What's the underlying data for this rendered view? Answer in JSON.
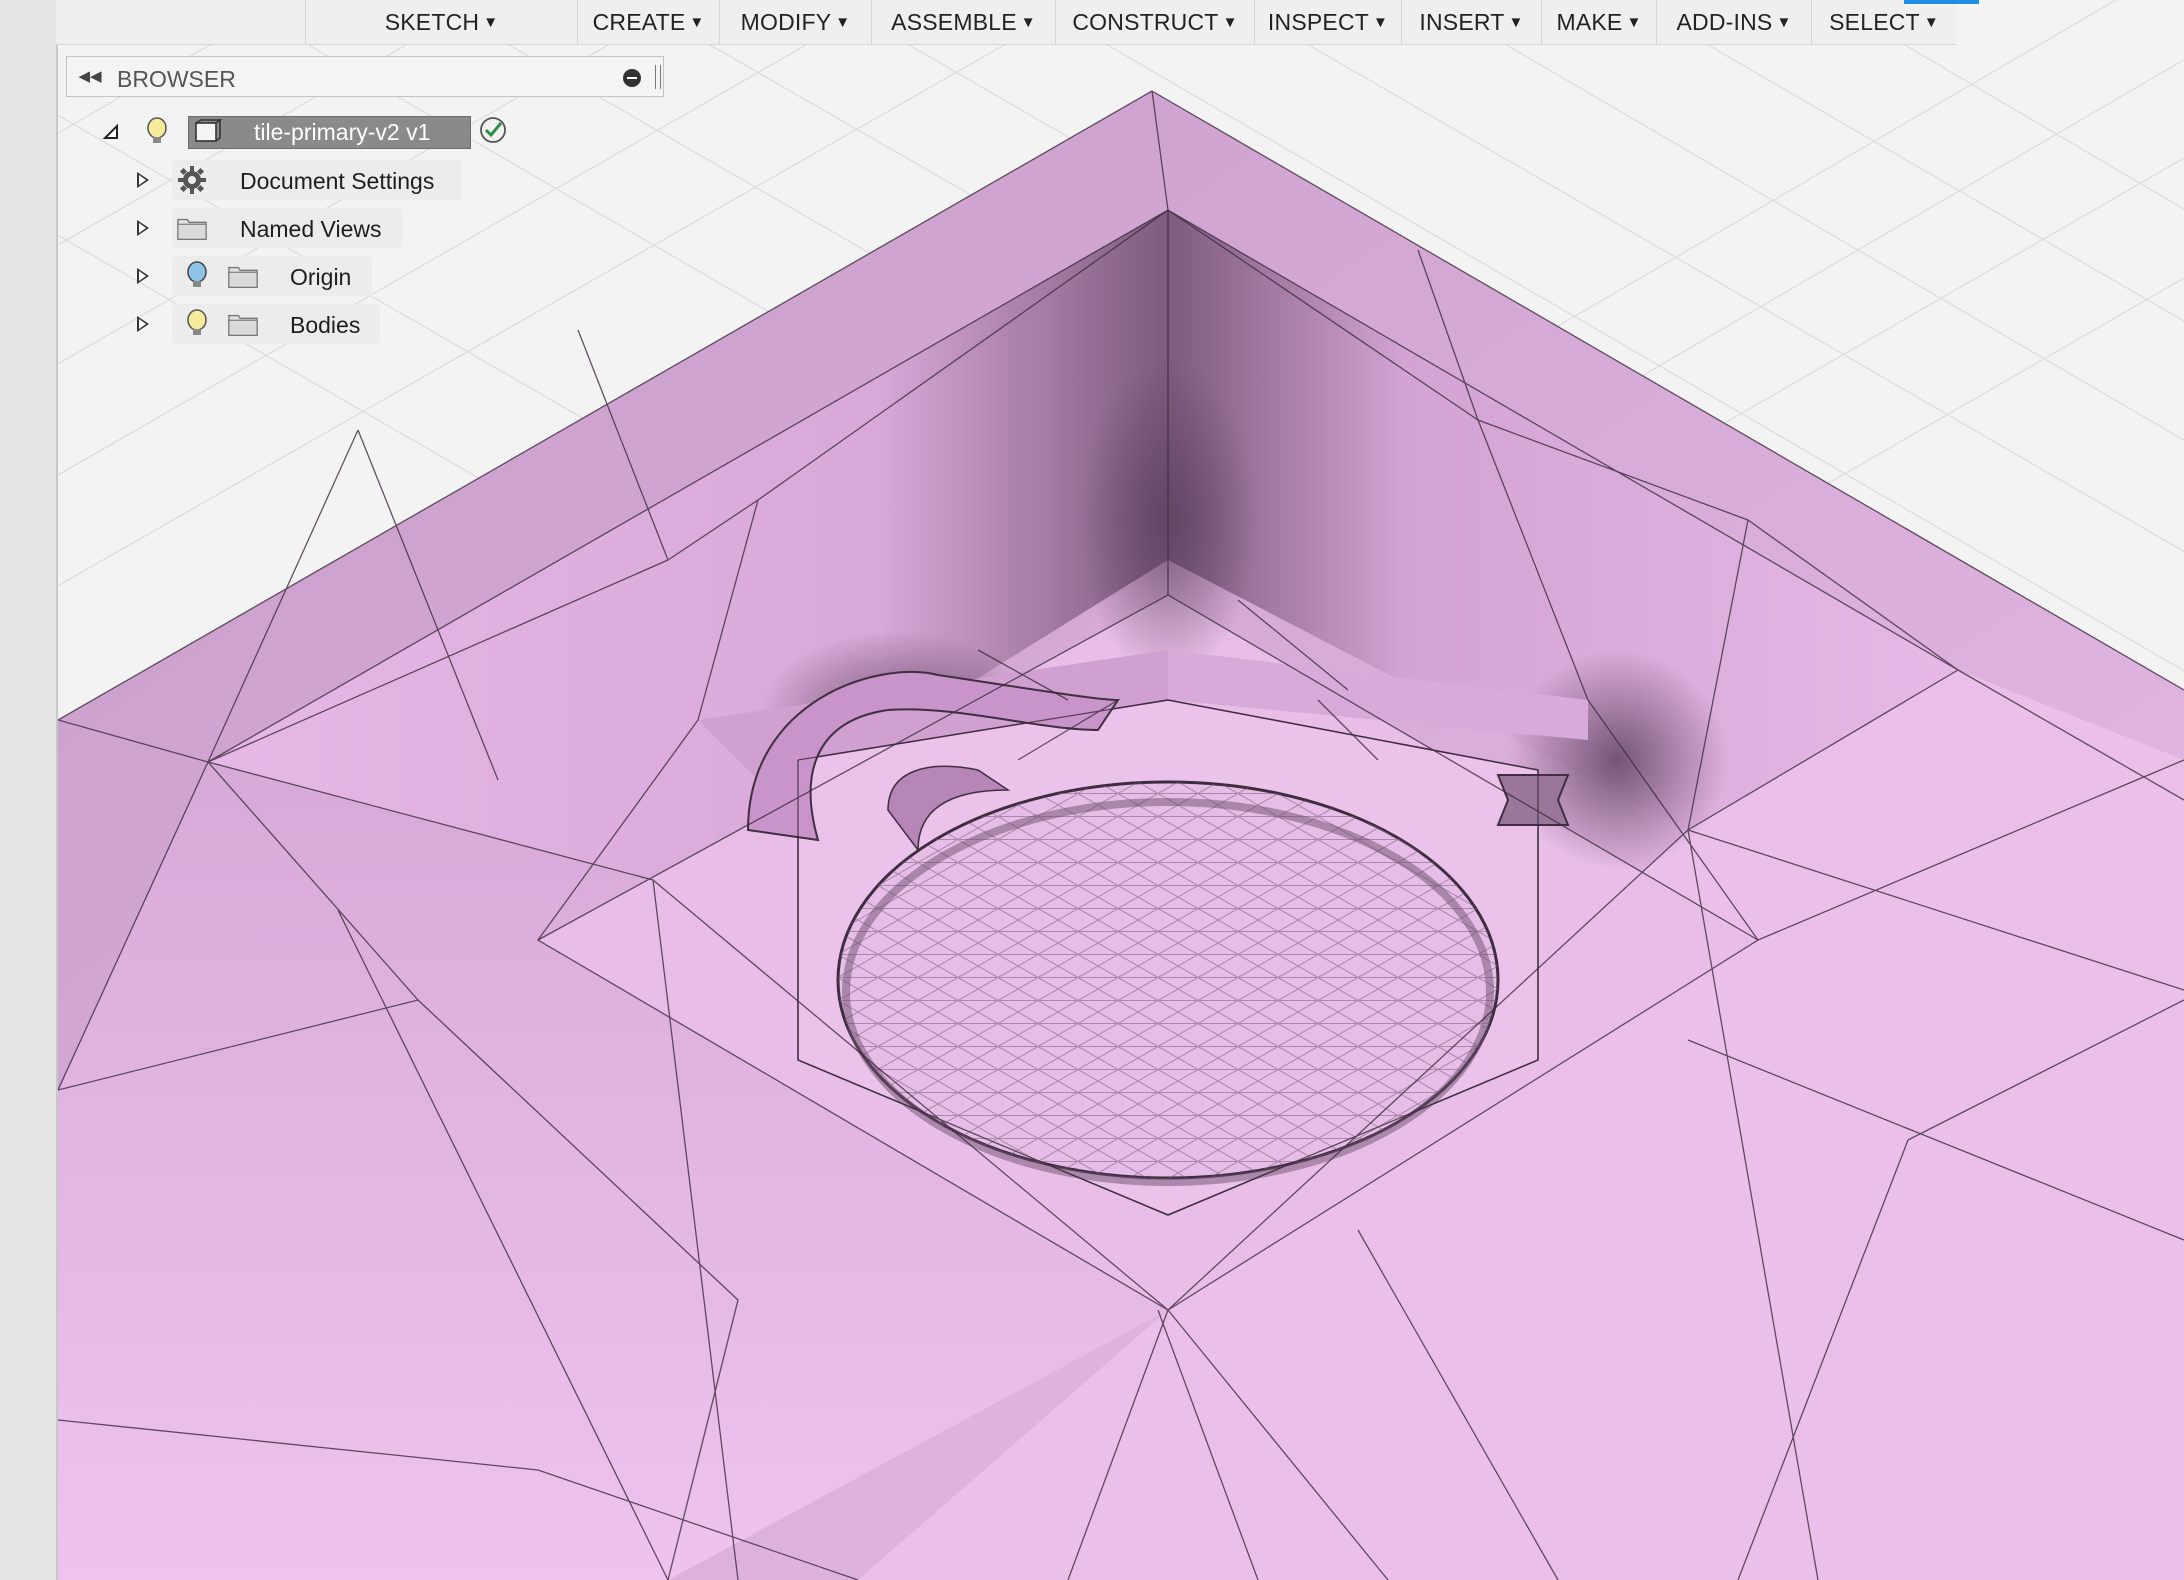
{
  "toolbar": {
    "items": [
      {
        "label": "SKETCH"
      },
      {
        "label": "CREATE"
      },
      {
        "label": "MODIFY"
      },
      {
        "label": "ASSEMBLE"
      },
      {
        "label": "CONSTRUCT"
      },
      {
        "label": "INSPECT"
      },
      {
        "label": "INSERT"
      },
      {
        "label": "MAKE"
      },
      {
        "label": "ADD-INS"
      },
      {
        "label": "SELECT"
      }
    ],
    "dropdown_icon": "caret-down-icon",
    "active_accent_color": "#1f8ee6"
  },
  "browser": {
    "title": "BROWSER",
    "collapse_icon": "double-chevron-left-icon",
    "minimize_icon": "minus-circle-icon",
    "root": {
      "label": "tile-primary-v2 v1",
      "icons": [
        "collapse-triangle-icon",
        "lightbulb-icon",
        "component-icon",
        "check-circle-icon"
      ]
    },
    "nodes": [
      {
        "label": "Document Settings",
        "icon": "gear-icon"
      },
      {
        "label": "Named Views",
        "icon": "folder-icon"
      },
      {
        "label": "Origin",
        "icon": "folder-icon",
        "visibility_icon": "lightbulb-icon"
      },
      {
        "label": "Bodies",
        "icon": "folder-icon",
        "visibility_icon": "lightbulb-icon"
      }
    ]
  },
  "viewport": {
    "model_color": "#e8bde8",
    "grid_color": "#dcdcdc",
    "background": "#f3f3f3"
  }
}
